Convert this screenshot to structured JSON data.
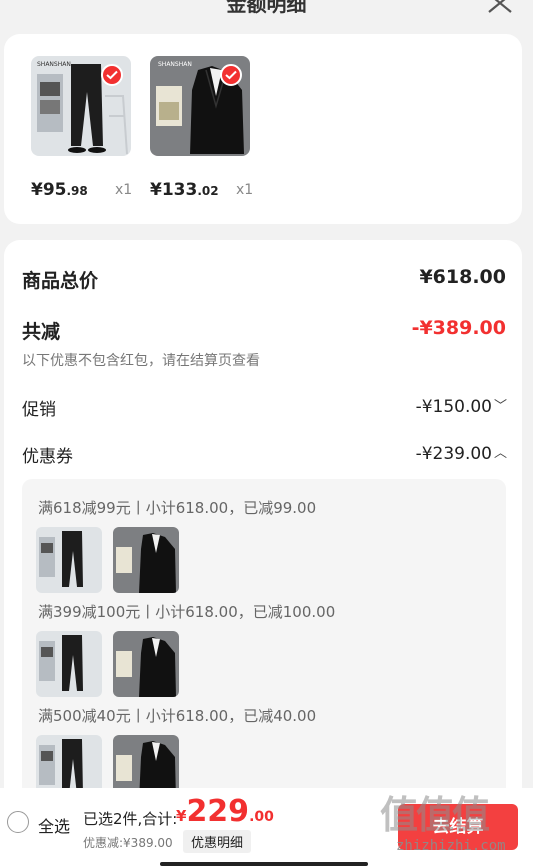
{
  "header": {
    "title": "金额明细"
  },
  "items": [
    {
      "price_int": "¥95",
      "price_dec": ".98",
      "qty": "x1",
      "brand": "SHANSHAN",
      "style": "light"
    },
    {
      "price_int": "¥133",
      "price_dec": ".02",
      "qty": "x1",
      "brand": "SHANSHAN",
      "style": "dark"
    }
  ],
  "summary": {
    "total_label": "商品总价",
    "total_value": "¥618.00",
    "reduce_label": "共减",
    "reduce_value": "-¥389.00",
    "note": "以下优惠不包含红包，请在结算页查看",
    "promo_label": "促销",
    "promo_value": "-¥150.00",
    "coupon_label": "优惠券",
    "coupon_value": "-¥239.00"
  },
  "coupon_groups": [
    {
      "title": "满618减99元丨小计618.00，已减99.00"
    },
    {
      "title": "满399减100元丨小计618.00，已减100.00"
    },
    {
      "title": "满500减40元丨小计618.00，已减40.00"
    }
  ],
  "bottom": {
    "select_all": "全选",
    "selected_sum": "已选2件,合计:",
    "total_yen": "¥",
    "total_int": "229",
    "total_dec": ".00",
    "discount_line": "优惠减:¥389.00",
    "detail_button": "优惠明细",
    "checkout_button": "去结算"
  },
  "watermark": {
    "logo": "值值值",
    "url": "zhizhizhi.com"
  },
  "colors": {
    "accent": "#f23030",
    "background": "#f2f2f2"
  }
}
